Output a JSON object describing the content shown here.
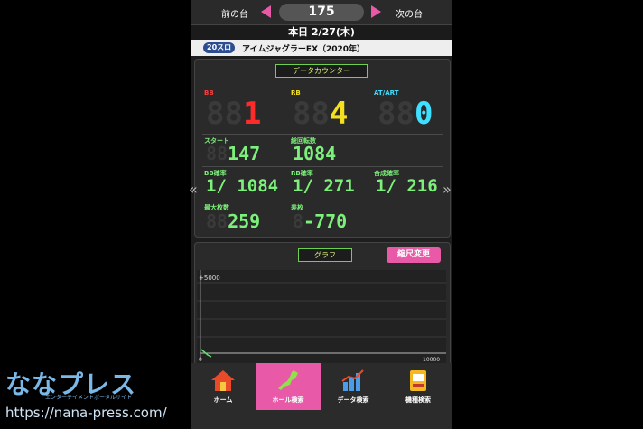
{
  "nav": {
    "prev_label": "前の台",
    "next_label": "次の台",
    "machine_number": "175"
  },
  "date": "本日 2/27(木)",
  "machine": {
    "rate": "20スロ",
    "name": "アイムジャグラーEX（2020年）"
  },
  "counter": {
    "title": "データカウンター",
    "bb": {
      "label": "BB",
      "ghost": "88",
      "value": "1"
    },
    "rb": {
      "label": "RB",
      "ghost": "88",
      "value": "4"
    },
    "at": {
      "label": "AT/ART",
      "ghost": "88",
      "value": "0"
    },
    "start": {
      "label": "スタート",
      "ghost": "88",
      "value": "147"
    },
    "total_spins": {
      "label": "総回転数",
      "ghost": "",
      "value": "1084"
    },
    "bb_prob": {
      "label": "BB確率",
      "value": "1/ 1084"
    },
    "rb_prob": {
      "label": "RB確率",
      "value": "1/  271"
    },
    "combined_prob": {
      "label": "合成確率",
      "value": "1/  216"
    },
    "max_coins": {
      "label": "最大枚数",
      "ghost": "88",
      "value": "259"
    },
    "diff_coins": {
      "label": "差枚",
      "ghost": "8",
      "value": "-770"
    }
  },
  "graph": {
    "title": "グラフ",
    "scale_button": "縮尺変更",
    "y_top_label": "+5000",
    "x_start_label": "0",
    "x_end_label": "10000"
  },
  "tabs": [
    {
      "label": "ホーム",
      "icon": "house-icon"
    },
    {
      "label": "ホール検索",
      "icon": "japan-map-icon"
    },
    {
      "label": "データ検索",
      "icon": "bar-chart-icon"
    },
    {
      "label": "機種検索",
      "icon": "slot-machine-icon"
    }
  ],
  "watermark": {
    "logo": "ななプレス",
    "tagline": "エンターテイメントポータルサイト",
    "url": "https://nana-press.com/"
  },
  "colors": {
    "accent_pink": "#e85aa8",
    "bb_red": "#ff2a2a",
    "rb_yellow": "#f5e020",
    "at_cyan": "#3fe0ff",
    "counter_green": "#7cf07a"
  }
}
